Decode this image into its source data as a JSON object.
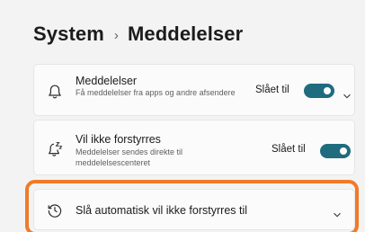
{
  "breadcrumb": {
    "parent": "System",
    "separator": "›",
    "current": "Meddelelser"
  },
  "settings": [
    {
      "title": "Meddelelser",
      "description": "Få meddelelser fra apps og andre afsendere",
      "state_label": "Slået til",
      "toggle_on": true,
      "icon": "bell-icon",
      "expandable": true
    },
    {
      "title": "Vil ikke forstyrres",
      "description": "Meddelelser sendes direkte til meddelelsescenteret",
      "state_label": "Slået til",
      "toggle_on": true,
      "icon": "bell-snooze-icon",
      "expandable": false
    },
    {
      "title": "Slå automatisk vil ikke forstyrres til",
      "icon": "clock-icon",
      "expandable": true
    }
  ],
  "colors": {
    "accent": "#1f6c7f",
    "highlight": "#f07b27",
    "background": "#f3f3f3",
    "card": "#fbfbfb"
  }
}
